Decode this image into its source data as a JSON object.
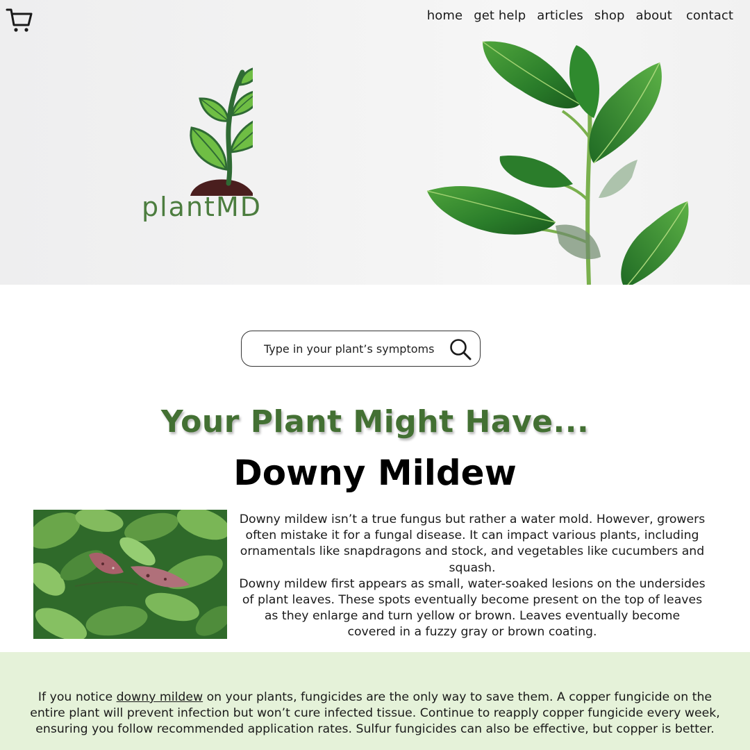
{
  "header": {
    "cart_icon": "shopping-cart-icon",
    "nav": [
      {
        "label": "home"
      },
      {
        "label": "get help"
      },
      {
        "label": "articles"
      },
      {
        "label": "shop"
      },
      {
        "label": "about"
      },
      {
        "label": "contact"
      }
    ]
  },
  "logo": {
    "text": "plantMD",
    "icon": "sprout-icon"
  },
  "search": {
    "placeholder": "Type in your plant’s symptoms",
    "icon": "search-icon"
  },
  "result": {
    "heading": "Your Plant Might Have...",
    "disease": "Downy Mildew",
    "paragraph_1": "Downy mildew isn’t a true fungus but rather a water mold. However, growers often mistake it for a fungal disease. It can impact various plants, including ornamentals like snapdragons and stock, and vegetables like cucumbers and squash.",
    "paragraph_2": "Downy mildew first appears as small, water-soaked lesions on the undersides of plant leaves. These spots eventually become present on the top of leaves as they enlarge and turn yellow or brown. Leaves eventually become covered in a fuzzy gray or brown coating."
  },
  "treatment": {
    "prefix": "If you notice ",
    "link": "downy mildew",
    "suffix": " on your plants, fungicides are the only way to save them. A copper fungicide on the entire plant will prevent infection but won’t cure infected tissue. Continue to reapply copper fungicide every week, ensuring you follow recommended application rates. Sulfur fungicides can also be effective, but copper is better."
  },
  "colors": {
    "brand_green": "#437033",
    "logo_green": "#4c7d3f",
    "treatment_bg": "#e5f2d9"
  }
}
